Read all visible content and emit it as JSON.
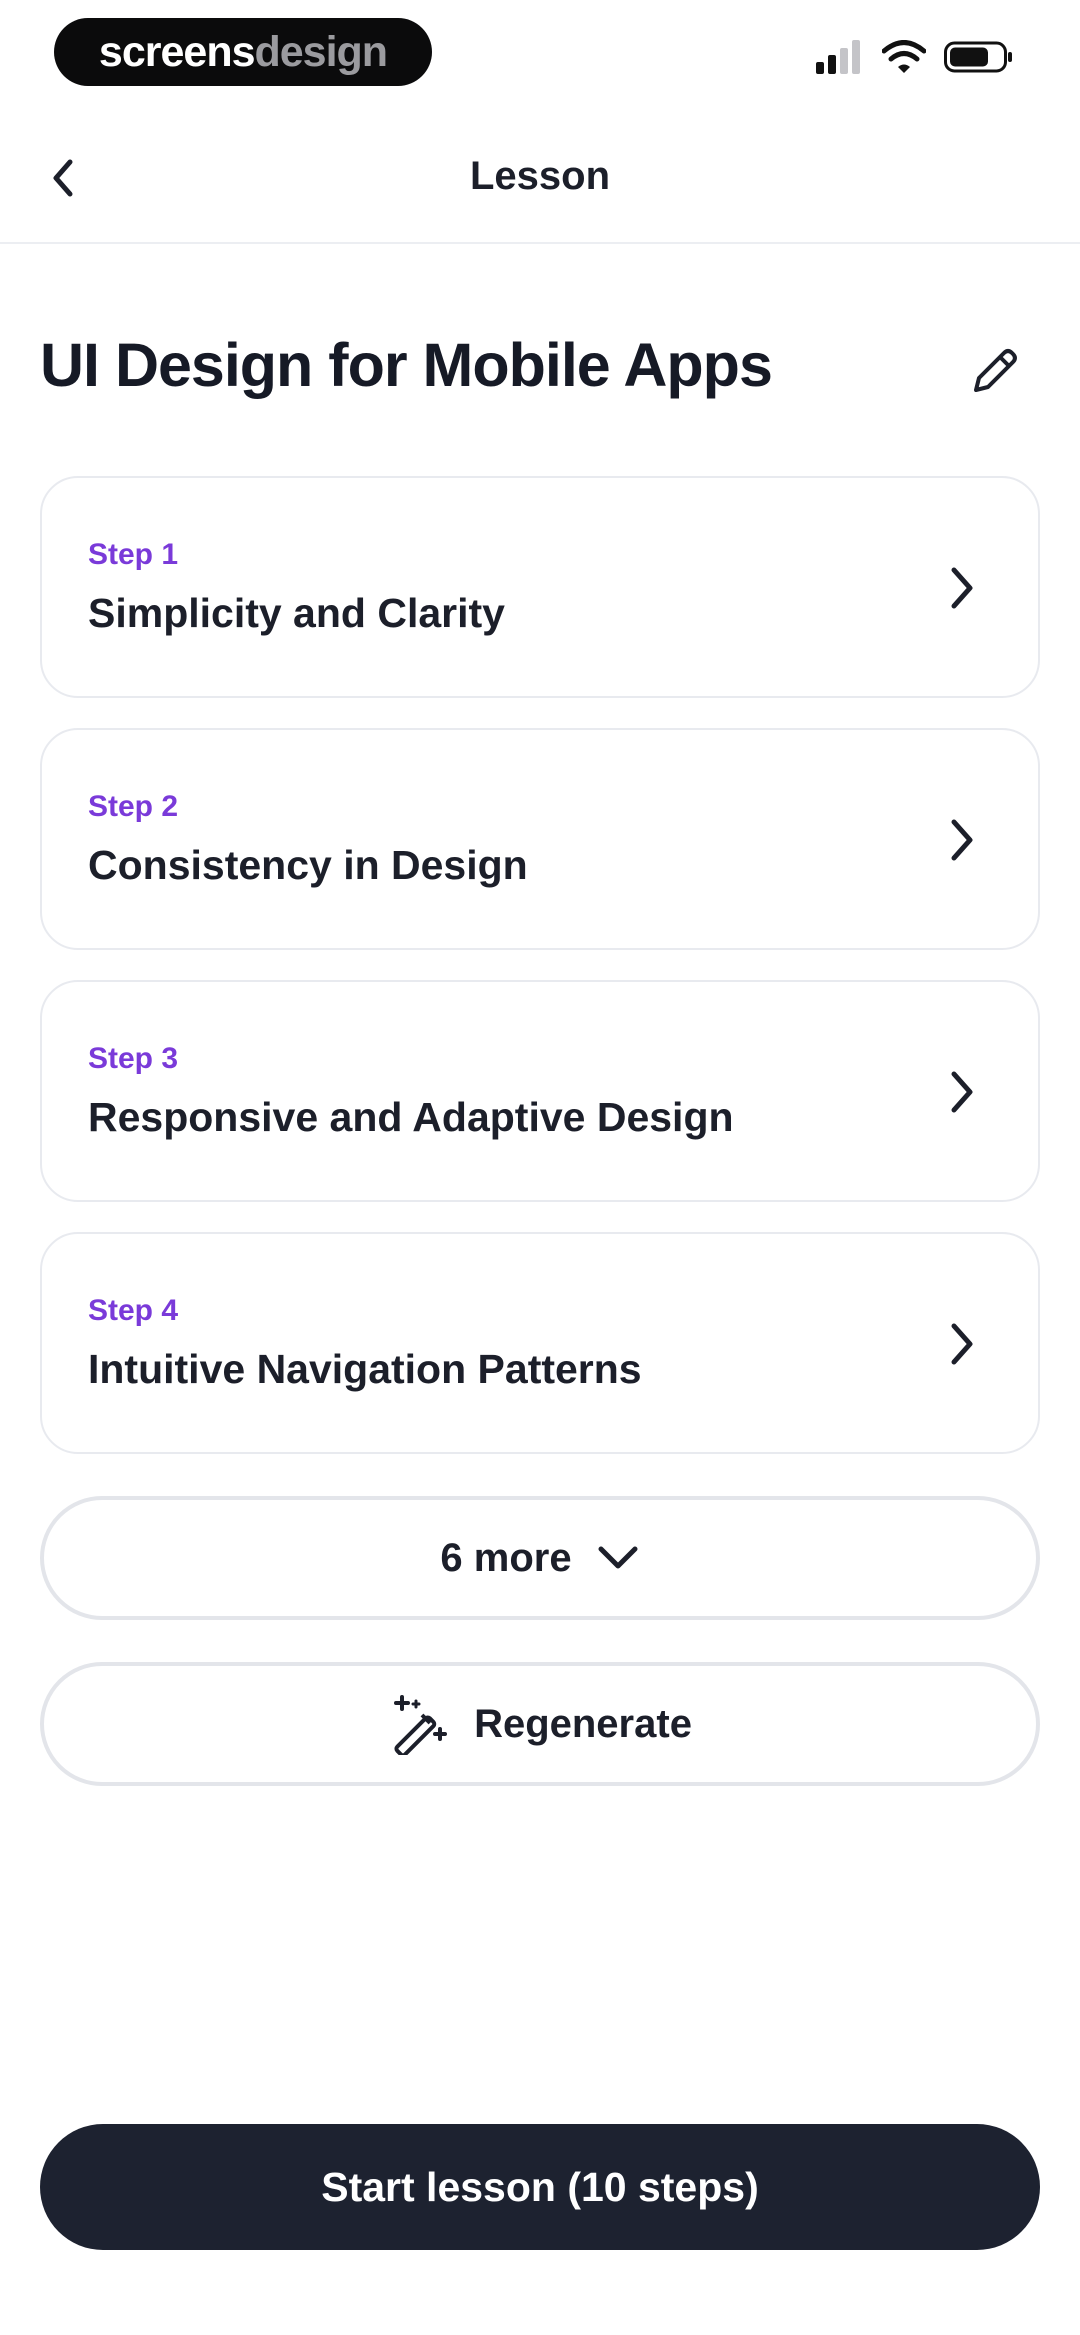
{
  "status_bar": {
    "brand_part1": "screens",
    "brand_part2": "design",
    "icons": [
      "signal-icon",
      "wifi-icon",
      "battery-icon"
    ]
  },
  "nav": {
    "title": "Lesson",
    "back_icon": "chevron-left-icon"
  },
  "lesson": {
    "title": "UI Design for Mobile Apps",
    "edit_icon": "pencil-icon"
  },
  "steps": [
    {
      "label": "Step 1",
      "title": "Simplicity and Clarity"
    },
    {
      "label": "Step 2",
      "title": "Consistency in Design"
    },
    {
      "label": "Step 3",
      "title": "Responsive and Adaptive Design"
    },
    {
      "label": "Step 4",
      "title": "Intuitive Navigation Patterns"
    }
  ],
  "more_button": {
    "label": "6 more",
    "icon": "chevron-down-icon"
  },
  "regenerate_button": {
    "label": "Regenerate",
    "icon": "magic-wand-icon"
  },
  "start_button": {
    "label": "Start lesson (10 steps)"
  },
  "colors": {
    "accent": "#7a3ad9",
    "primary_button": "#1d2230",
    "text": "#1c1f2a",
    "border": "#e8eaef"
  }
}
